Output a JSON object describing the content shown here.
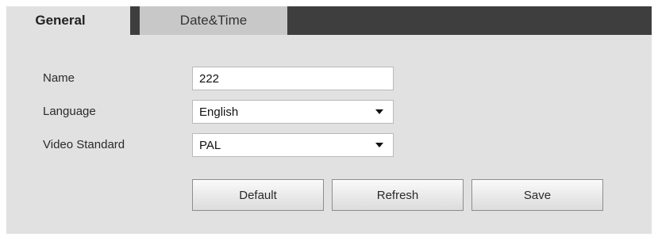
{
  "tabs": {
    "general": "General",
    "date_time": "Date&Time"
  },
  "form": {
    "name_label": "Name",
    "name_value": "222",
    "language_label": "Language",
    "language_value": "English",
    "video_standard_label": "Video Standard",
    "video_standard_value": "PAL"
  },
  "buttons": {
    "default": "Default",
    "refresh": "Refresh",
    "save": "Save"
  },
  "colors": {
    "panel_background": "#e1e1e1",
    "tabbar_background": "#3e3e3e",
    "inactive_tab": "#c8c8c8"
  }
}
